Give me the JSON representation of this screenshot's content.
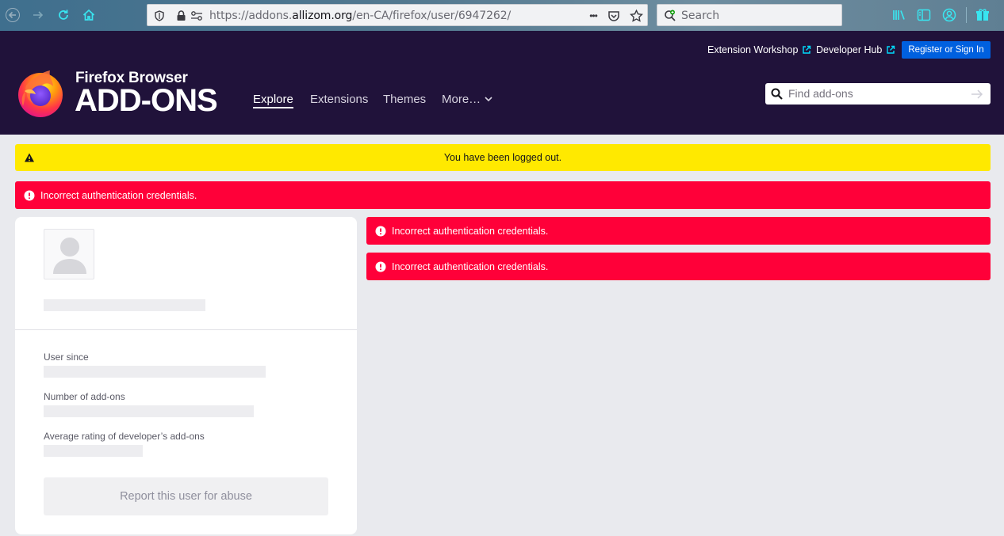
{
  "browser": {
    "url_prefix": "https://addons.",
    "url_domain": "allizom.org",
    "url_path": "/en-CA/firefox/user/6947262/",
    "search_placeholder": "Search",
    "overflow_glyph": "•••"
  },
  "header": {
    "links": [
      {
        "label": "Extension Workshop"
      },
      {
        "label": "Developer Hub"
      }
    ],
    "register_label": "Register or Sign In",
    "brand_top": "Firefox Browser",
    "brand_main": "ADD-ONS",
    "nav": [
      {
        "label": "Explore",
        "active": true
      },
      {
        "label": "Extensions",
        "active": false
      },
      {
        "label": "Themes",
        "active": false
      },
      {
        "label": "More…",
        "active": false
      }
    ],
    "search_placeholder": "Find add-ons"
  },
  "notices": {
    "logged_out": "You have been logged out.",
    "errors": [
      "Incorrect authentication credentials.",
      "Incorrect authentication credentials.",
      "Incorrect authentication credentials."
    ]
  },
  "profile": {
    "user_since_label": "User since",
    "addons_label": "Number of add-ons",
    "rating_label": "Average rating of developer’s add-ons",
    "report_label": "Report this user for abuse"
  },
  "colors": {
    "header_bg": "#20123a",
    "accent_blue": "#0060df",
    "warning": "#ffe900",
    "error": "#ff0039"
  }
}
